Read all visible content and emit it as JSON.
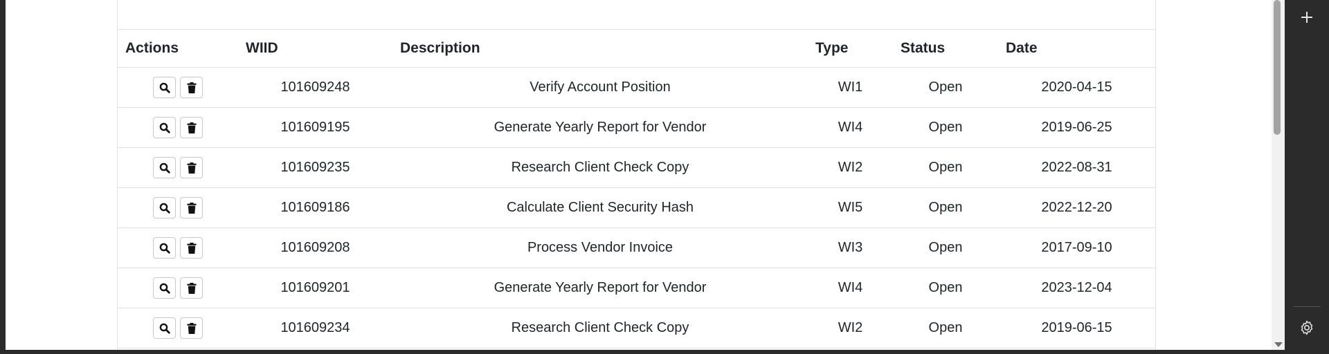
{
  "table": {
    "headers": {
      "actions": "Actions",
      "wiid": "WIID",
      "description": "Description",
      "type": "Type",
      "status": "Status",
      "date": "Date"
    },
    "rows": [
      {
        "wiid": "101609248",
        "description": "Verify Account Position",
        "type": "WI1",
        "status": "Open",
        "date": "2020-04-15"
      },
      {
        "wiid": "101609195",
        "description": "Generate Yearly Report for Vendor",
        "type": "WI4",
        "status": "Open",
        "date": "2019-06-25"
      },
      {
        "wiid": "101609235",
        "description": "Research Client Check Copy",
        "type": "WI2",
        "status": "Open",
        "date": "2022-08-31"
      },
      {
        "wiid": "101609186",
        "description": "Calculate Client Security Hash",
        "type": "WI5",
        "status": "Open",
        "date": "2022-12-20"
      },
      {
        "wiid": "101609208",
        "description": "Process Vendor Invoice",
        "type": "WI3",
        "status": "Open",
        "date": "2017-09-10"
      },
      {
        "wiid": "101609201",
        "description": "Generate Yearly Report for Vendor",
        "type": "WI4",
        "status": "Open",
        "date": "2023-12-04"
      },
      {
        "wiid": "101609234",
        "description": "Research Client Check Copy",
        "type": "WI2",
        "status": "Open",
        "date": "2019-06-15"
      }
    ]
  },
  "row_icons": {
    "view": "search-icon",
    "delete": "trash-icon"
  },
  "rail_icons": {
    "top": "plus-icon",
    "bottom": "gear-icon"
  }
}
